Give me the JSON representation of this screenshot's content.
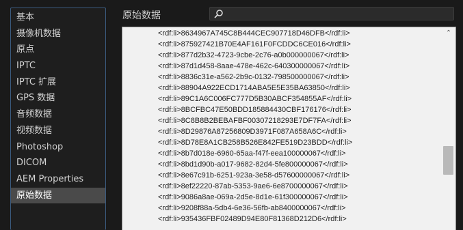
{
  "sidebar": {
    "items": [
      {
        "label": "基本",
        "selected": false
      },
      {
        "label": "摄像机数据",
        "selected": false
      },
      {
        "label": "原点",
        "selected": false
      },
      {
        "label": "IPTC",
        "selected": false
      },
      {
        "label": "IPTC 扩展",
        "selected": false
      },
      {
        "label": "GPS 数据",
        "selected": false
      },
      {
        "label": "音频数据",
        "selected": false
      },
      {
        "label": "视频数据",
        "selected": false
      },
      {
        "label": "Photoshop",
        "selected": false
      },
      {
        "label": "DICOM",
        "selected": false
      },
      {
        "label": "AEM Properties",
        "selected": false
      },
      {
        "label": "原始数据",
        "selected": true
      }
    ]
  },
  "header": {
    "title": "原始数据",
    "search_placeholder": "",
    "search_icon": "search-icon"
  },
  "raw_data": {
    "lines": [
      "<rdf:li>8634967A745C8B444CEC907718D46DFB</rdf:li>",
      "<rdf:li>875927421B70E4AF161F0FCDDC6CE016</rdf:li>",
      "<rdf:li>877d2b32-4723-9cbe-2c76-a0b000000067</rdf:li>",
      "<rdf:li>87d1d458-8aae-478e-462c-640300000067</rdf:li>",
      "<rdf:li>8836c31e-a562-2b9c-0132-798500000067</rdf:li>",
      "<rdf:li>88904A922ECD1714ABA5E5E35BA63850</rdf:li>",
      "<rdf:li>89C1A6C006FC777D5B30ABCF354855AF</rdf:li>",
      "<rdf:li>8BCFBC47E50BDD185884430CBF176176</rdf:li>",
      "<rdf:li>8C8B8B2BEBAFBF00307218293E7DF7FA</rdf:li>",
      "<rdf:li>8D29876A87256809D3971F087A658A6C</rdf:li>",
      "<rdf:li>8D78E8A1CB258B526E842FE519D23BDD</rdf:li>",
      "<rdf:li>8b7d018e-6960-65aa-f47f-eea100000067</rdf:li>",
      "<rdf:li>8bd1d90b-a017-9682-82d4-5fe800000067</rdf:li>",
      "<rdf:li>8e67c91b-6251-923a-3e58-d57600000067</rdf:li>",
      "<rdf:li>8ef22220-87ab-5353-9ae6-6e8700000067</rdf:li>",
      "<rdf:li>9086a8ae-069a-2d5e-8d1e-61f300000067</rdf:li>",
      "<rdf:li>9208f88a-5db4-6e36-56fb-ab8400000067</rdf:li>",
      "<rdf:li>935436FBF02489D94E80F81368D212D6</rdf:li>"
    ],
    "scroll_up_icon": "chevron-up-icon"
  }
}
